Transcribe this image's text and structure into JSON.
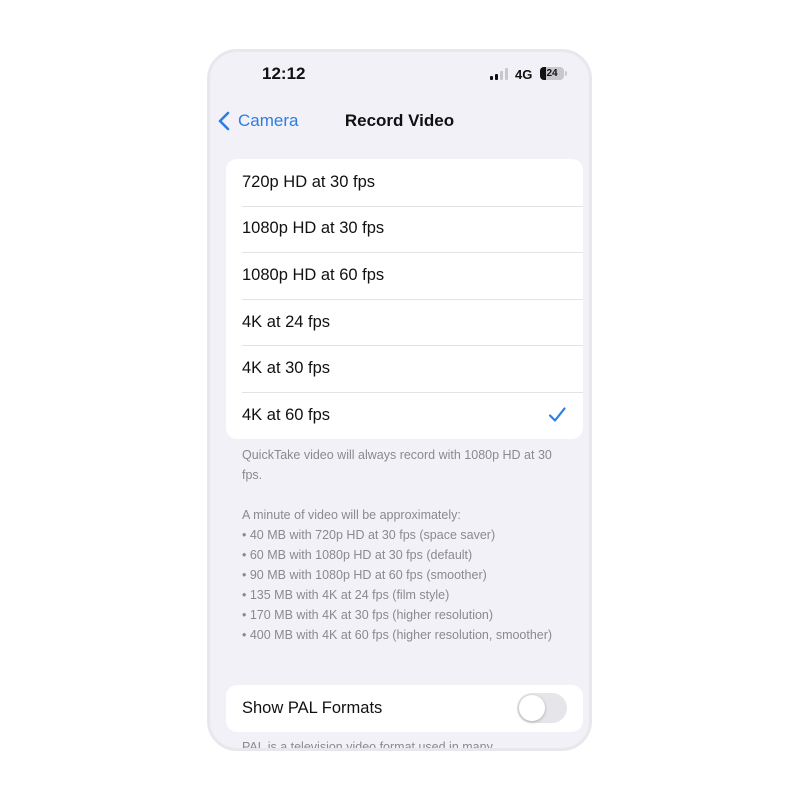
{
  "status_bar": {
    "time": "12:12",
    "network": "4G",
    "battery": "24",
    "battery_percent": 24
  },
  "nav": {
    "back_label": "Camera",
    "title": "Record Video"
  },
  "options": [
    {
      "label": "720p HD at 30 fps",
      "selected": false
    },
    {
      "label": "1080p HD at 30 fps",
      "selected": false
    },
    {
      "label": "1080p HD at 60 fps",
      "selected": false
    },
    {
      "label": "4K at 24 fps",
      "selected": false
    },
    {
      "label": "4K at 30 fps",
      "selected": false
    },
    {
      "label": "4K at 60 fps",
      "selected": true
    }
  ],
  "quicktake_note": "QuickTake video will always record with 1080p HD at 30 fps.",
  "size_note": {
    "heading": "A minute of video will be approximately:",
    "lines": [
      "• 40 MB with 720p HD at 30 fps (space saver)",
      "• 60 MB with 1080p HD at 30 fps (default)",
      "• 90 MB with 1080p HD at 60 fps (smoother)",
      "• 135 MB with 4K at 24 fps (film style)",
      "• 170 MB with 4K at 30 fps (higher resolution)",
      "• 400 MB with 4K at 60 fps (higher resolution, smoother)"
    ]
  },
  "pal": {
    "label": "Show PAL Formats",
    "enabled": false,
    "note": "PAL is a television video format used in many"
  },
  "colors": {
    "accent": "#2f7de1",
    "background": "#f1f1f7",
    "secondary_text": "#8a8a8e"
  }
}
